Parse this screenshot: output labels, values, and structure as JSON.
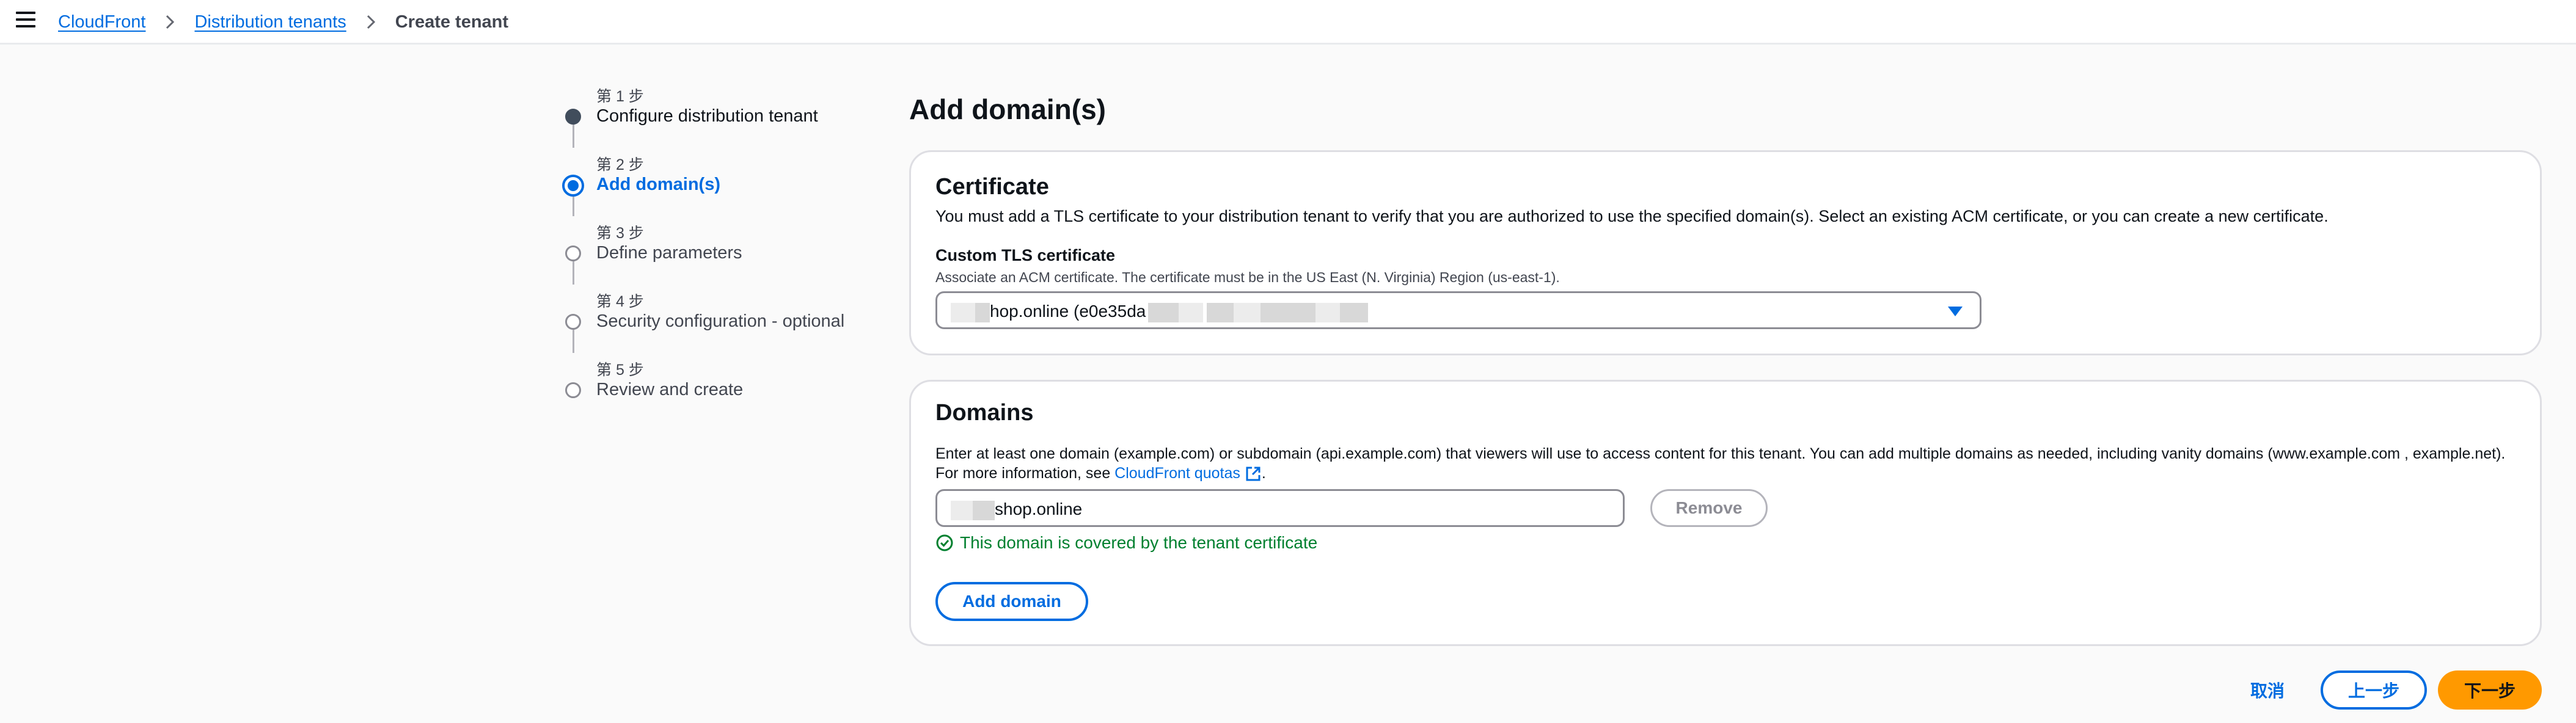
{
  "breadcrumb": {
    "items": [
      "CloudFront",
      "Distribution tenants"
    ],
    "current": "Create tenant"
  },
  "steps": [
    {
      "num": "第 1 步",
      "label": "Configure distribution tenant",
      "state": "done"
    },
    {
      "num": "第 2 步",
      "label": "Add domain(s)",
      "state": "active"
    },
    {
      "num": "第 3 步",
      "label": "Define parameters",
      "state": "pending"
    },
    {
      "num": "第 4 步",
      "label": "Security configuration - optional",
      "state": "pending"
    },
    {
      "num": "第 5 步",
      "label": "Review and create",
      "state": "pending"
    }
  ],
  "page_title": "Add domain(s)",
  "certificate": {
    "heading": "Certificate",
    "description": "You must add a TLS certificate to your distribution tenant to verify that you are authorized to use the specified domain(s). Select an existing ACM certificate, or you can create a new certificate.",
    "field_label": "Custom TLS certificate",
    "field_desc": "Associate an ACM certificate. The certificate must be in the US East (N. Virginia) Region (us-east-1).",
    "selected_value_visible": "hop.online (e0e35da"
  },
  "domains": {
    "heading": "Domains",
    "description_line1": "Enter at least one domain (example.com) or subdomain (api.example.com) that viewers will use to access content for this tenant. You can add multiple domains as needed, including vanity domains (www.example.com , example.net).",
    "description_line2_prefix": "For more information, see",
    "quotas_link": "CloudFront quotas",
    "description_line2_suffix": ".",
    "domain_value_visible": "shop.online",
    "remove_label": "Remove",
    "success_text": "This domain is covered by the tenant certificate",
    "add_label": "Add domain"
  },
  "footer": {
    "cancel_label": "取消",
    "prev_label": "上一步",
    "next_label": "下一步"
  },
  "colors": {
    "link": "#006ce0",
    "primary_button": "#ff9900",
    "success": "#00802f"
  }
}
